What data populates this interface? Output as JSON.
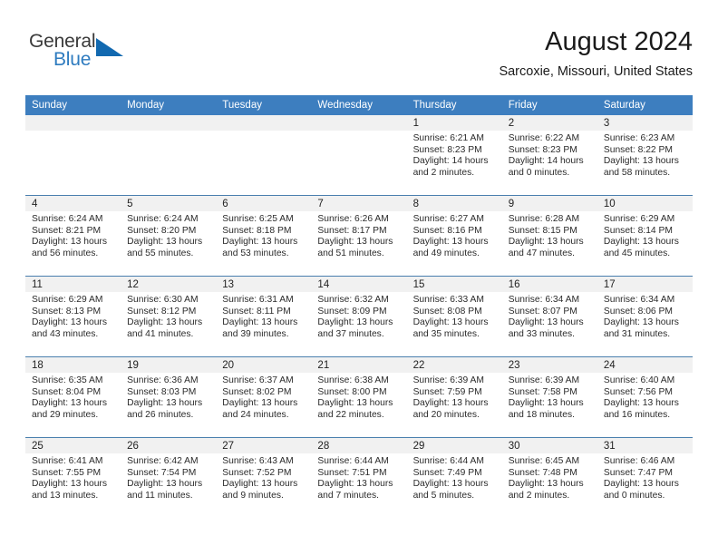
{
  "brand": {
    "name_part1": "General",
    "name_part2": "Blue",
    "triangle_color": "#1269b0",
    "blue_color": "#2e7bbf"
  },
  "header": {
    "title": "August 2024",
    "subtitle": "Sarcoxie, Missouri, United States"
  },
  "theme": {
    "header_bg": "#3d7ebf",
    "daynum_bg": "#f1f1f1",
    "row_border": "#4a7fae"
  },
  "weekday_headers": [
    "Sunday",
    "Monday",
    "Tuesday",
    "Wednesday",
    "Thursday",
    "Friday",
    "Saturday"
  ],
  "weeks": [
    [
      {
        "day": "",
        "sunrise": "",
        "sunset": "",
        "daylight_line1": "",
        "daylight_line2": ""
      },
      {
        "day": "",
        "sunrise": "",
        "sunset": "",
        "daylight_line1": "",
        "daylight_line2": ""
      },
      {
        "day": "",
        "sunrise": "",
        "sunset": "",
        "daylight_line1": "",
        "daylight_line2": ""
      },
      {
        "day": "",
        "sunrise": "",
        "sunset": "",
        "daylight_line1": "",
        "daylight_line2": ""
      },
      {
        "day": "1",
        "sunrise": "Sunrise: 6:21 AM",
        "sunset": "Sunset: 8:23 PM",
        "daylight_line1": "Daylight: 14 hours",
        "daylight_line2": "and 2 minutes."
      },
      {
        "day": "2",
        "sunrise": "Sunrise: 6:22 AM",
        "sunset": "Sunset: 8:23 PM",
        "daylight_line1": "Daylight: 14 hours",
        "daylight_line2": "and 0 minutes."
      },
      {
        "day": "3",
        "sunrise": "Sunrise: 6:23 AM",
        "sunset": "Sunset: 8:22 PM",
        "daylight_line1": "Daylight: 13 hours",
        "daylight_line2": "and 58 minutes."
      }
    ],
    [
      {
        "day": "4",
        "sunrise": "Sunrise: 6:24 AM",
        "sunset": "Sunset: 8:21 PM",
        "daylight_line1": "Daylight: 13 hours",
        "daylight_line2": "and 56 minutes."
      },
      {
        "day": "5",
        "sunrise": "Sunrise: 6:24 AM",
        "sunset": "Sunset: 8:20 PM",
        "daylight_line1": "Daylight: 13 hours",
        "daylight_line2": "and 55 minutes."
      },
      {
        "day": "6",
        "sunrise": "Sunrise: 6:25 AM",
        "sunset": "Sunset: 8:18 PM",
        "daylight_line1": "Daylight: 13 hours",
        "daylight_line2": "and 53 minutes."
      },
      {
        "day": "7",
        "sunrise": "Sunrise: 6:26 AM",
        "sunset": "Sunset: 8:17 PM",
        "daylight_line1": "Daylight: 13 hours",
        "daylight_line2": "and 51 minutes."
      },
      {
        "day": "8",
        "sunrise": "Sunrise: 6:27 AM",
        "sunset": "Sunset: 8:16 PM",
        "daylight_line1": "Daylight: 13 hours",
        "daylight_line2": "and 49 minutes."
      },
      {
        "day": "9",
        "sunrise": "Sunrise: 6:28 AM",
        "sunset": "Sunset: 8:15 PM",
        "daylight_line1": "Daylight: 13 hours",
        "daylight_line2": "and 47 minutes."
      },
      {
        "day": "10",
        "sunrise": "Sunrise: 6:29 AM",
        "sunset": "Sunset: 8:14 PM",
        "daylight_line1": "Daylight: 13 hours",
        "daylight_line2": "and 45 minutes."
      }
    ],
    [
      {
        "day": "11",
        "sunrise": "Sunrise: 6:29 AM",
        "sunset": "Sunset: 8:13 PM",
        "daylight_line1": "Daylight: 13 hours",
        "daylight_line2": "and 43 minutes."
      },
      {
        "day": "12",
        "sunrise": "Sunrise: 6:30 AM",
        "sunset": "Sunset: 8:12 PM",
        "daylight_line1": "Daylight: 13 hours",
        "daylight_line2": "and 41 minutes."
      },
      {
        "day": "13",
        "sunrise": "Sunrise: 6:31 AM",
        "sunset": "Sunset: 8:11 PM",
        "daylight_line1": "Daylight: 13 hours",
        "daylight_line2": "and 39 minutes."
      },
      {
        "day": "14",
        "sunrise": "Sunrise: 6:32 AM",
        "sunset": "Sunset: 8:09 PM",
        "daylight_line1": "Daylight: 13 hours",
        "daylight_line2": "and 37 minutes."
      },
      {
        "day": "15",
        "sunrise": "Sunrise: 6:33 AM",
        "sunset": "Sunset: 8:08 PM",
        "daylight_line1": "Daylight: 13 hours",
        "daylight_line2": "and 35 minutes."
      },
      {
        "day": "16",
        "sunrise": "Sunrise: 6:34 AM",
        "sunset": "Sunset: 8:07 PM",
        "daylight_line1": "Daylight: 13 hours",
        "daylight_line2": "and 33 minutes."
      },
      {
        "day": "17",
        "sunrise": "Sunrise: 6:34 AM",
        "sunset": "Sunset: 8:06 PM",
        "daylight_line1": "Daylight: 13 hours",
        "daylight_line2": "and 31 minutes."
      }
    ],
    [
      {
        "day": "18",
        "sunrise": "Sunrise: 6:35 AM",
        "sunset": "Sunset: 8:04 PM",
        "daylight_line1": "Daylight: 13 hours",
        "daylight_line2": "and 29 minutes."
      },
      {
        "day": "19",
        "sunrise": "Sunrise: 6:36 AM",
        "sunset": "Sunset: 8:03 PM",
        "daylight_line1": "Daylight: 13 hours",
        "daylight_line2": "and 26 minutes."
      },
      {
        "day": "20",
        "sunrise": "Sunrise: 6:37 AM",
        "sunset": "Sunset: 8:02 PM",
        "daylight_line1": "Daylight: 13 hours",
        "daylight_line2": "and 24 minutes."
      },
      {
        "day": "21",
        "sunrise": "Sunrise: 6:38 AM",
        "sunset": "Sunset: 8:00 PM",
        "daylight_line1": "Daylight: 13 hours",
        "daylight_line2": "and 22 minutes."
      },
      {
        "day": "22",
        "sunrise": "Sunrise: 6:39 AM",
        "sunset": "Sunset: 7:59 PM",
        "daylight_line1": "Daylight: 13 hours",
        "daylight_line2": "and 20 minutes."
      },
      {
        "day": "23",
        "sunrise": "Sunrise: 6:39 AM",
        "sunset": "Sunset: 7:58 PM",
        "daylight_line1": "Daylight: 13 hours",
        "daylight_line2": "and 18 minutes."
      },
      {
        "day": "24",
        "sunrise": "Sunrise: 6:40 AM",
        "sunset": "Sunset: 7:56 PM",
        "daylight_line1": "Daylight: 13 hours",
        "daylight_line2": "and 16 minutes."
      }
    ],
    [
      {
        "day": "25",
        "sunrise": "Sunrise: 6:41 AM",
        "sunset": "Sunset: 7:55 PM",
        "daylight_line1": "Daylight: 13 hours",
        "daylight_line2": "and 13 minutes."
      },
      {
        "day": "26",
        "sunrise": "Sunrise: 6:42 AM",
        "sunset": "Sunset: 7:54 PM",
        "daylight_line1": "Daylight: 13 hours",
        "daylight_line2": "and 11 minutes."
      },
      {
        "day": "27",
        "sunrise": "Sunrise: 6:43 AM",
        "sunset": "Sunset: 7:52 PM",
        "daylight_line1": "Daylight: 13 hours",
        "daylight_line2": "and 9 minutes."
      },
      {
        "day": "28",
        "sunrise": "Sunrise: 6:44 AM",
        "sunset": "Sunset: 7:51 PM",
        "daylight_line1": "Daylight: 13 hours",
        "daylight_line2": "and 7 minutes."
      },
      {
        "day": "29",
        "sunrise": "Sunrise: 6:44 AM",
        "sunset": "Sunset: 7:49 PM",
        "daylight_line1": "Daylight: 13 hours",
        "daylight_line2": "and 5 minutes."
      },
      {
        "day": "30",
        "sunrise": "Sunrise: 6:45 AM",
        "sunset": "Sunset: 7:48 PM",
        "daylight_line1": "Daylight: 13 hours",
        "daylight_line2": "and 2 minutes."
      },
      {
        "day": "31",
        "sunrise": "Sunrise: 6:46 AM",
        "sunset": "Sunset: 7:47 PM",
        "daylight_line1": "Daylight: 13 hours",
        "daylight_line2": "and 0 minutes."
      }
    ]
  ]
}
